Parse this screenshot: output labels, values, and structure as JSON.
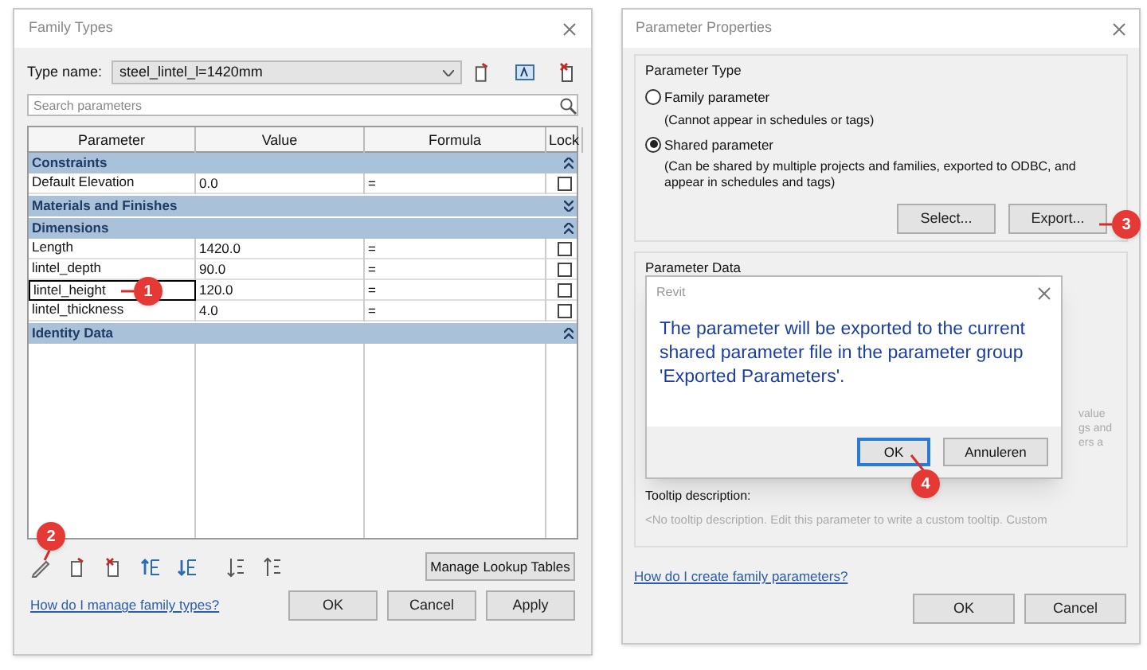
{
  "family_types": {
    "title": "Family Types",
    "type_name_label": "Type name:",
    "type_name_value": "steel_lintel_l=1420mm",
    "search": {
      "placeholder": "Search parameters"
    },
    "columns": [
      "Parameter",
      "Value",
      "Formula",
      "Lock"
    ],
    "groups": [
      {
        "label": "Constraints",
        "expanded": true,
        "rows": [
          {
            "parameter": "Default Elevation",
            "value": "0.0",
            "formula": "=",
            "locked": false,
            "selected": false
          }
        ]
      },
      {
        "label": "Materials and Finishes",
        "expanded": false
      },
      {
        "label": "Dimensions",
        "expanded": true,
        "rows": [
          {
            "parameter": "Length",
            "value": "1420.0",
            "formula": "=",
            "locked": false,
            "selected": false
          },
          {
            "parameter": "lintel_depth",
            "value": "90.0",
            "formula": "=",
            "locked": false,
            "selected": false
          },
          {
            "parameter": "lintel_height",
            "value": "120.0",
            "formula": "=",
            "locked": false,
            "selected": true
          },
          {
            "parameter": "lintel_thickness",
            "value": "4.0",
            "formula": "=",
            "locked": false,
            "selected": false
          }
        ]
      },
      {
        "label": "Identity Data",
        "expanded": true
      }
    ],
    "manage_button": "Manage Lookup Tables",
    "help_link": "How do I manage family types?",
    "buttons": [
      "OK",
      "Cancel",
      "Apply"
    ]
  },
  "parameter_properties": {
    "title": "Parameter Properties",
    "type_group": "Parameter Type",
    "options": [
      {
        "label": "Family parameter",
        "note": "(Cannot appear in schedules or tags)",
        "selected": false
      },
      {
        "label": "Shared parameter",
        "note": "(Can be shared by multiple projects and families, exported to ODBC, and appear in schedules and tags)",
        "selected": true
      }
    ],
    "type_buttons": [
      "Select...",
      "Export..."
    ],
    "data_group": "Parameter Data",
    "hidden_fragments": [
      "value",
      "gs and",
      "ers a"
    ],
    "tooltip_label": "Tooltip description:",
    "tooltip_text": "<No tooltip description. Edit this parameter to write a custom tooltip. Custom",
    "help_link": "How do I create family parameters?",
    "buttons": [
      "OK",
      "Cancel"
    ]
  },
  "revit_popup": {
    "title": "Revit",
    "message": "The parameter will be exported to the current shared parameter file in the parameter group 'Exported Parameters'.",
    "buttons": [
      {
        "label": "OK",
        "selected": true
      },
      {
        "label": "Annuleren",
        "selected": false
      }
    ]
  },
  "callouts": [
    "1",
    "2",
    "3",
    "4"
  ]
}
